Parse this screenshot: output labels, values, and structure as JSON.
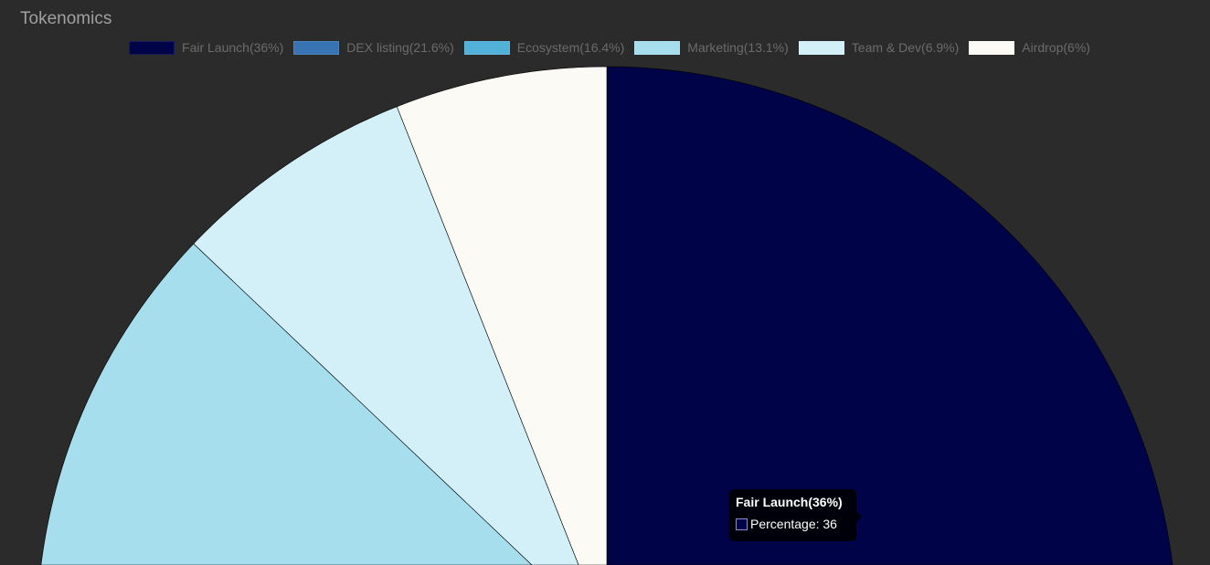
{
  "chart_data": {
    "type": "pie",
    "title": "Tokenomics",
    "legend_position": "top",
    "series_name": "Percentage",
    "categories": [
      "Fair Launch(36%)",
      "DEX listing(21.6%)",
      "Ecosystem(16.4%)",
      "Marketing(13.1%)",
      "Team & Dev(6.9%)",
      "Airdrop(6%)"
    ],
    "values": [
      36,
      21.6,
      16.4,
      13.1,
      6.9,
      6
    ],
    "colors": [
      "#000347",
      "#3874b3",
      "#52b1d8",
      "#a6deee",
      "#d3eff7",
      "#fcfaf5"
    ]
  },
  "tooltip": {
    "title": "Fair Launch(36%)",
    "label": "Percentage: 36",
    "color": "#000347"
  }
}
